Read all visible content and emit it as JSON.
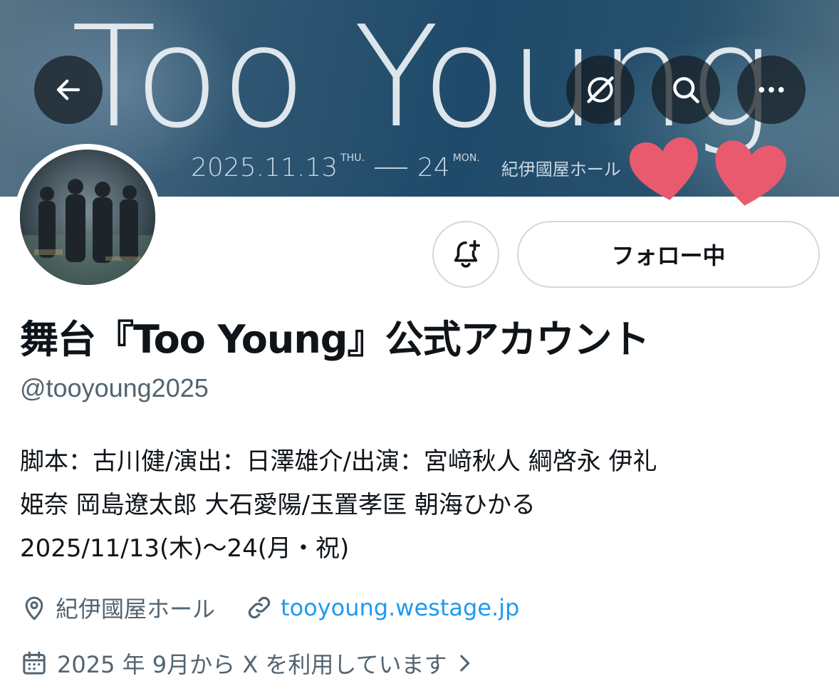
{
  "banner": {
    "title": "Too Young",
    "date_start": "2025.11.13",
    "date_start_day": "THU.",
    "date_end": "24",
    "date_end_day": "MON.",
    "venue": "紀伊國屋ホール"
  },
  "nav": {
    "back_icon": "arrow-left-icon",
    "grok_icon": "grok-icon",
    "search_icon": "search-icon",
    "more_icon": "more-horizontal-icon"
  },
  "profile": {
    "display_name": "舞台『Too Young』公式アカウント",
    "handle": "@tooyoung2025",
    "follow_label": "フォロー中",
    "notify_icon": "bell-plus-icon",
    "bio_lines": [
      "脚本：古川健/演出：日澤雄介/出演：宮﨑秋人 綱啓永 伊礼",
      "姫奈 岡島遼太郎 大石愛陽/玉置孝匡 朝海ひかる",
      "2025/11/13(木)～24(月・祝)"
    ],
    "location": "紀伊國屋ホール",
    "website": "tooyoung.westage.jp",
    "joined": "2025 年 9月から X を利用しています"
  },
  "colors": {
    "link": "#1d9bf0",
    "secondary_text": "#536471",
    "border": "#cfd9de",
    "heart": "#e95a6f"
  }
}
